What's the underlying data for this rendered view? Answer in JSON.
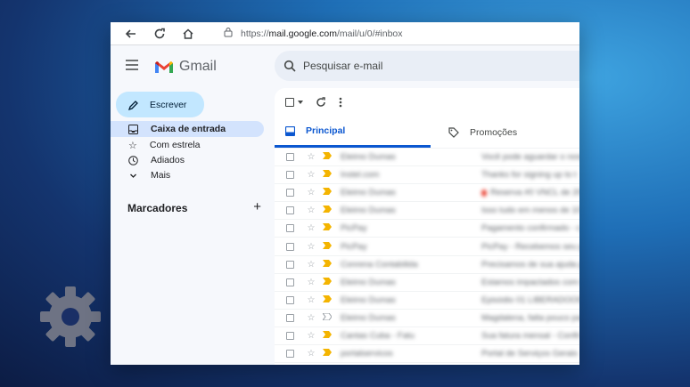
{
  "browser": {
    "url_prefix": "https://",
    "url_domain": "mail.google.com",
    "url_path": "/mail/u/0/#inbox"
  },
  "app": {
    "name": "Gmail"
  },
  "search": {
    "placeholder": "Pesquisar e-mail"
  },
  "sidebar": {
    "compose_label": "Escrever",
    "items": [
      {
        "label": "Caixa de entrada",
        "icon": "inbox-icon"
      },
      {
        "label": "Com estrela",
        "icon": "star-icon"
      },
      {
        "label": "Adiados",
        "icon": "clock-icon"
      },
      {
        "label": "Mais",
        "icon": "chevron-down-icon"
      }
    ],
    "labels_title": "Marcadores"
  },
  "tabs": [
    {
      "label": "Principal"
    },
    {
      "label": "Promoções"
    }
  ],
  "colors": {
    "accent": "#0b57d0",
    "compose_bg": "#c2e7ff",
    "active_nav": "#d3e3fd",
    "important": "#f4b400"
  },
  "emails": [
    {
      "sender": "Eleimo Dumas",
      "subject": "Você pode aguardar o nosso"
    },
    {
      "sender": "Instel.com",
      "subject": "Thanks for signing up to t"
    },
    {
      "sender": "Eleimo Dumas",
      "subject": "Reserva #0 VNCL de 200",
      "red_dot": true
    },
    {
      "sender": "Eleimo Dumas",
      "subject": "Isso tudo em menos de 10"
    },
    {
      "sender": "PicPay",
      "subject": "Pagamento confirmado - c"
    },
    {
      "sender": "PicPay",
      "subject": "PicPay - Recebemos seu pa"
    },
    {
      "sender": "Conrena Contabilida",
      "subject": "Precisamos de sua ajuda p"
    },
    {
      "sender": "Eleimo Dumas",
      "subject": "Estamos impactados com r"
    },
    {
      "sender": "Eleimo Dumas",
      "subject": "Episódio 01 LIBERADOOOO"
    },
    {
      "sender": "Eleimo Dumas",
      "subject": "Magdalena, falta pouco pa"
    },
    {
      "sender": "Cantas Cuba - Fatu",
      "subject": "Sua fatura mensal - Confir"
    },
    {
      "sender": "portalservicos",
      "subject": "Portal de Serviços Gerais"
    }
  ]
}
